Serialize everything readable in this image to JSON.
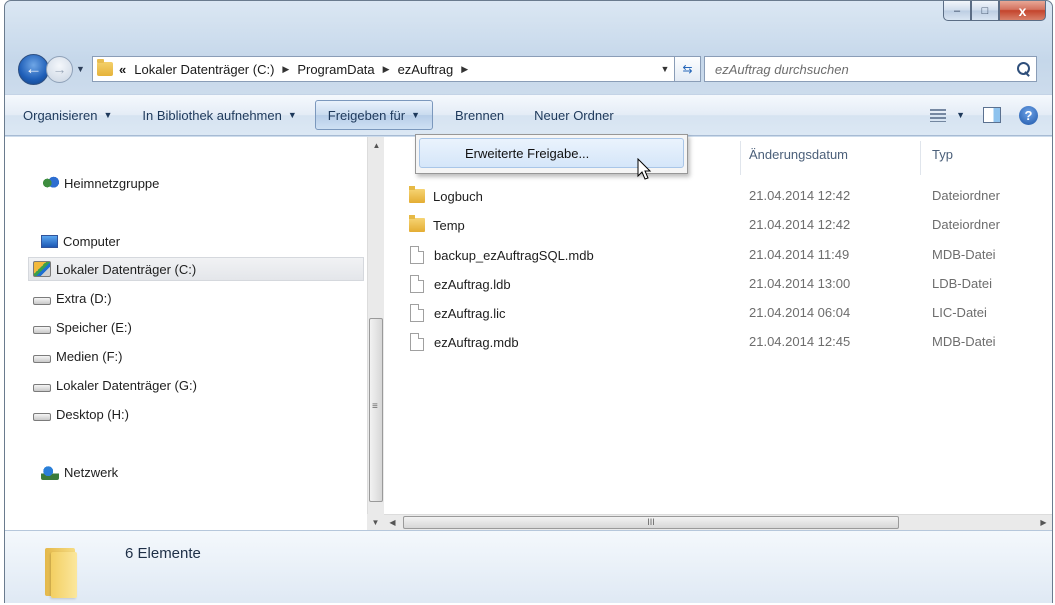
{
  "window": {
    "minimize": "–",
    "maximize": "□",
    "close": "x"
  },
  "address": {
    "prefix": "«",
    "crumbs": [
      "Lokaler Datenträger (C:)",
      "ProgramData",
      "ezAuftrag"
    ]
  },
  "search": {
    "placeholder": "ezAuftrag durchsuchen"
  },
  "toolbar": {
    "organize": "Organisieren",
    "library": "In Bibliothek aufnehmen",
    "share": "Freigeben für",
    "burn": "Brennen",
    "new_folder": "Neuer Ordner"
  },
  "menu": {
    "advanced_sharing": "Erweiterte Freigabe..."
  },
  "nav": {
    "homegroup": "Heimnetzgruppe",
    "computer": "Computer",
    "drives": [
      "Lokaler Datenträger (C:)",
      "Extra (D:)",
      "Speicher (E:)",
      "Medien (F:)",
      "Lokaler Datenträger (G:)",
      "Desktop (H:)"
    ],
    "network": "Netzwerk"
  },
  "columns": {
    "name": "N",
    "date": "Änderungsdatum",
    "type": "Typ"
  },
  "files": [
    {
      "name": "Logbuch",
      "date": "21.04.2014 12:42",
      "type": "Dateiordner",
      "icon": "folder-icon"
    },
    {
      "name": "Temp",
      "date": "21.04.2014 12:42",
      "type": "Dateiordner",
      "icon": "folder-icon"
    },
    {
      "name": "backup_ezAuftragSQL.mdb",
      "date": "21.04.2014 11:49",
      "type": "MDB-Datei",
      "icon": "file-icon"
    },
    {
      "name": "ezAuftrag.ldb",
      "date": "21.04.2014 13:00",
      "type": "LDB-Datei",
      "icon": "file-icon"
    },
    {
      "name": "ezAuftrag.lic",
      "date": "21.04.2014 06:04",
      "type": "LIC-Datei",
      "icon": "file-icon"
    },
    {
      "name": "ezAuftrag.mdb",
      "date": "21.04.2014 12:45",
      "type": "MDB-Datei",
      "icon": "file-icon"
    }
  ],
  "status": {
    "count": "6 Elemente"
  },
  "scrollbar": {
    "h_grip": "III"
  }
}
